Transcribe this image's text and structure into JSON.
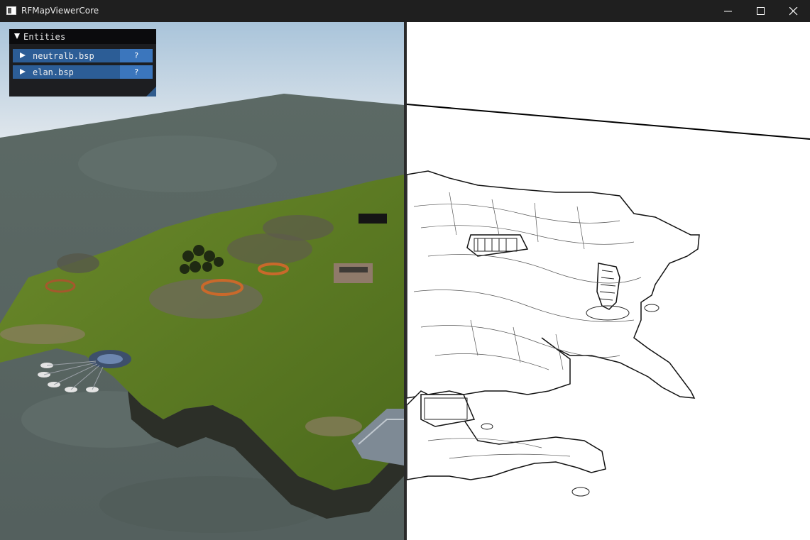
{
  "window": {
    "title": "RFMapViewerCore",
    "minimize_label": "",
    "maximize_label": "",
    "close_label": ""
  },
  "icons": {
    "app": "app-window-icon",
    "minimize": "minimize-icon",
    "maximize": "maximize-icon",
    "close": "close-icon",
    "collapse": "collapse-arrow-icon",
    "expand": "expand-arrow-icon"
  },
  "entities_panel": {
    "title": "Entities",
    "items": [
      {
        "label": "neutralb.bsp",
        "help": "?"
      },
      {
        "label": "elan.bsp",
        "help": "?"
      }
    ]
  },
  "colors": {
    "titlebar": "#1f1f1f",
    "panel_bg": "#121214",
    "row_bg": "#2c5d96",
    "help_bg": "#3b76bd",
    "divider": "#2a2a2a",
    "outline_bg": "#ffffff"
  }
}
